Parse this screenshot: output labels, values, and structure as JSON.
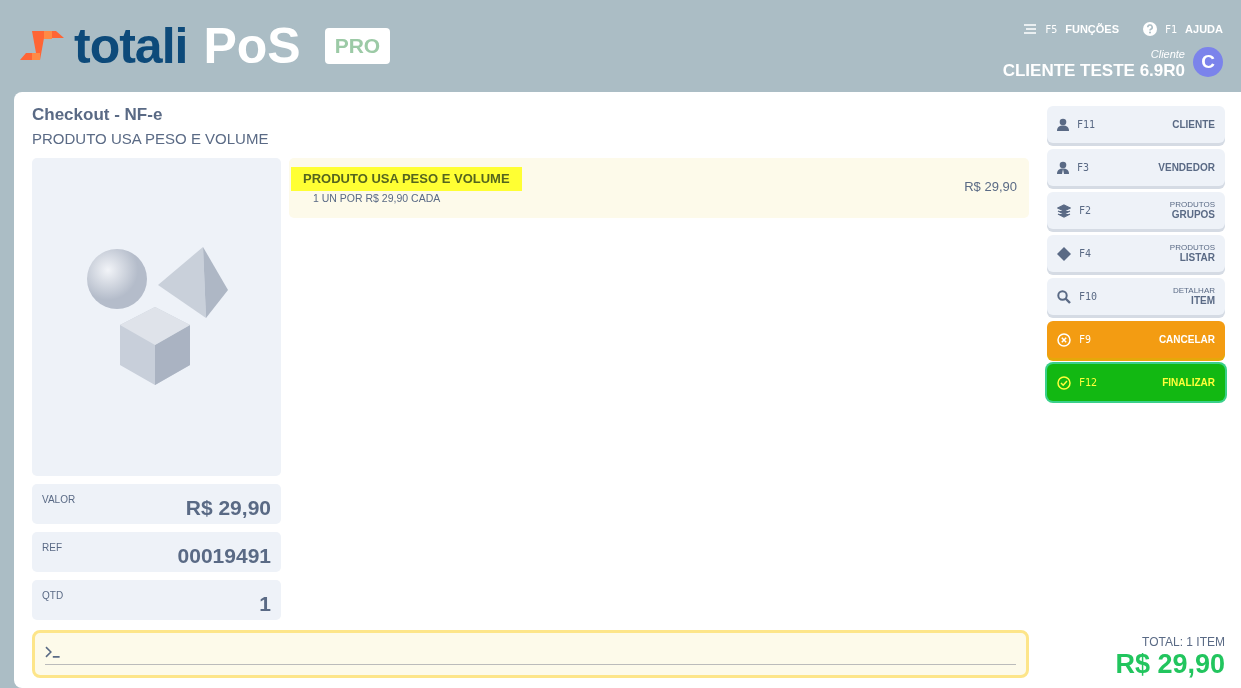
{
  "header": {
    "logo": {
      "brand": "totali",
      "product": "PoS",
      "edition": "PRO"
    },
    "actions": [
      {
        "key": "F5",
        "label": "FUNÇÕES"
      },
      {
        "key": "F1",
        "label": "AJUDA"
      }
    ],
    "client": {
      "caption": "Cliente",
      "name": "CLIENTE TESTE 6.9R0",
      "initial": "C"
    }
  },
  "checkout": {
    "title": "Checkout - NF-e",
    "subtitle": "PRODUTO USA PESO E VOLUME"
  },
  "details": [
    {
      "label": "VALOR",
      "value": "R$ 29,90"
    },
    {
      "label": "REF",
      "value": "00019491"
    },
    {
      "label": "QTD",
      "value": "1"
    }
  ],
  "items": [
    {
      "name": "PRODUTO USA PESO E VOLUME",
      "detail": "1 UN POR R$ 29,90 CADA",
      "price": "R$ 29,90",
      "selected": true
    }
  ],
  "buttons": [
    {
      "kind": "default",
      "key": "F11",
      "label": "CLIENTE"
    },
    {
      "kind": "default",
      "key": "F3",
      "label": "VENDEDOR"
    },
    {
      "kind": "default",
      "key": "F2",
      "caption": "PRODUTOS",
      "label": "GRUPOS"
    },
    {
      "kind": "default",
      "key": "F4",
      "caption": "PRODUTOS",
      "label": "LISTAR"
    },
    {
      "kind": "default",
      "key": "F10",
      "caption": "DETALHAR",
      "label": "ITEM"
    },
    {
      "kind": "warning",
      "key": "F9",
      "label": "CANCELAR"
    },
    {
      "kind": "success",
      "key": "F12",
      "label": "FINALIZAR"
    }
  ],
  "total": {
    "caption": "TOTAL: 1 ITEM",
    "value": "R$ 29,90"
  }
}
